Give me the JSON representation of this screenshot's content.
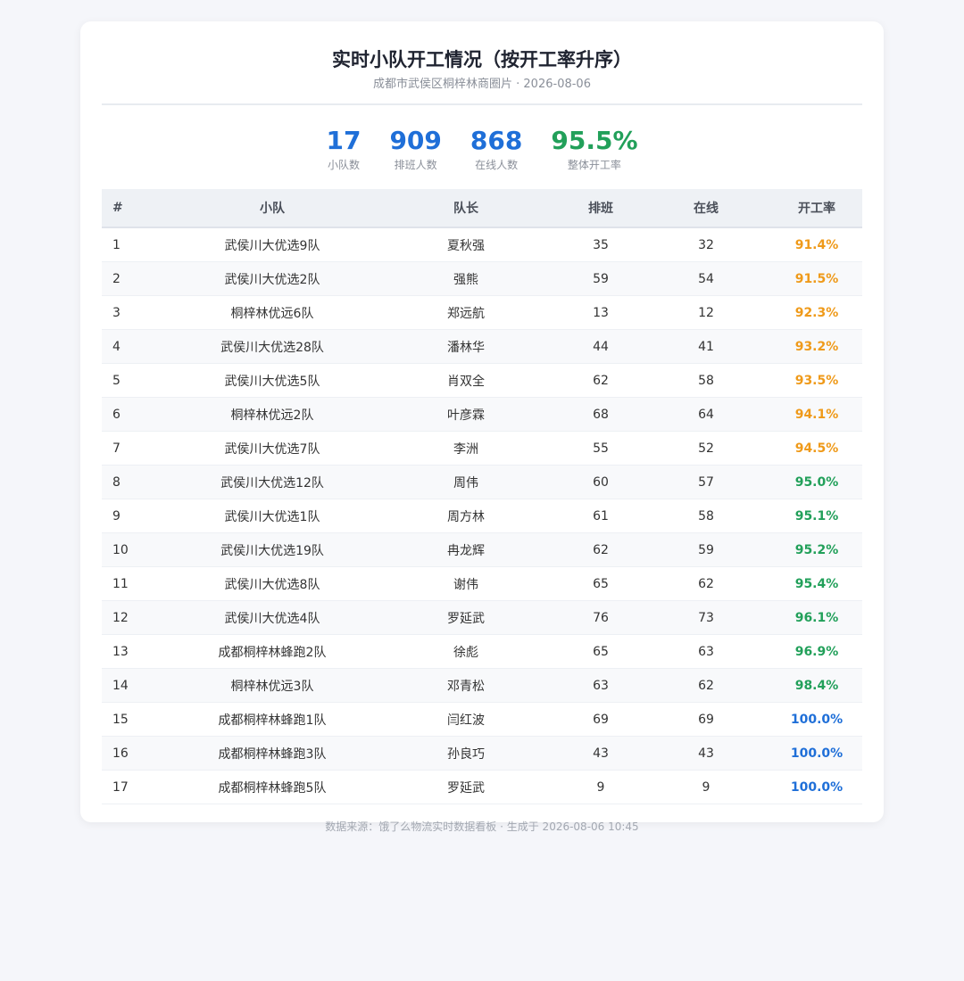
{
  "header": {
    "title": "实时小队开工情况（按开工率升序）",
    "subtitle": "成都市武侯区桐梓林商圈片 · 2026-08-06"
  },
  "stats": [
    {
      "value": "17",
      "label": "小队数",
      "color": "#1f6fd8"
    },
    {
      "value": "909",
      "label": "排班人数",
      "color": "#1f6fd8"
    },
    {
      "value": "868",
      "label": "在线人数",
      "color": "#1f6fd8"
    },
    {
      "value": "95.5%",
      "label": "整体开工率",
      "color": "#22a05a"
    }
  ],
  "table": {
    "columns": [
      "#",
      "小队",
      "队长",
      "排班",
      "在线",
      "开工率"
    ],
    "rows": [
      {
        "idx": "1",
        "team": "武侯川大优选9队",
        "leader": "夏秋强",
        "scheduled": "35",
        "online": "32",
        "rate": "91.4%",
        "rate_color": "orange"
      },
      {
        "idx": "2",
        "team": "武侯川大优选2队",
        "leader": "强熊",
        "scheduled": "59",
        "online": "54",
        "rate": "91.5%",
        "rate_color": "orange"
      },
      {
        "idx": "3",
        "team": "桐梓林优远6队",
        "leader": "郑远航",
        "scheduled": "13",
        "online": "12",
        "rate": "92.3%",
        "rate_color": "orange"
      },
      {
        "idx": "4",
        "team": "武侯川大优选28队",
        "leader": "潘林华",
        "scheduled": "44",
        "online": "41",
        "rate": "93.2%",
        "rate_color": "orange"
      },
      {
        "idx": "5",
        "team": "武侯川大优选5队",
        "leader": "肖双全",
        "scheduled": "62",
        "online": "58",
        "rate": "93.5%",
        "rate_color": "orange"
      },
      {
        "idx": "6",
        "team": "桐梓林优远2队",
        "leader": "叶彦霖",
        "scheduled": "68",
        "online": "64",
        "rate": "94.1%",
        "rate_color": "orange"
      },
      {
        "idx": "7",
        "team": "武侯川大优选7队",
        "leader": "李洲",
        "scheduled": "55",
        "online": "52",
        "rate": "94.5%",
        "rate_color": "orange"
      },
      {
        "idx": "8",
        "team": "武侯川大优选12队",
        "leader": "周伟",
        "scheduled": "60",
        "online": "57",
        "rate": "95.0%",
        "rate_color": "green"
      },
      {
        "idx": "9",
        "team": "武侯川大优选1队",
        "leader": "周方林",
        "scheduled": "61",
        "online": "58",
        "rate": "95.1%",
        "rate_color": "green"
      },
      {
        "idx": "10",
        "team": "武侯川大优选19队",
        "leader": "冉龙辉",
        "scheduled": "62",
        "online": "59",
        "rate": "95.2%",
        "rate_color": "green"
      },
      {
        "idx": "11",
        "team": "武侯川大优选8队",
        "leader": "谢伟",
        "scheduled": "65",
        "online": "62",
        "rate": "95.4%",
        "rate_color": "green"
      },
      {
        "idx": "12",
        "team": "武侯川大优选4队",
        "leader": "罗延武",
        "scheduled": "76",
        "online": "73",
        "rate": "96.1%",
        "rate_color": "green"
      },
      {
        "idx": "13",
        "team": "成都桐梓林蜂跑2队",
        "leader": "徐彪",
        "scheduled": "65",
        "online": "63",
        "rate": "96.9%",
        "rate_color": "green"
      },
      {
        "idx": "14",
        "team": "桐梓林优远3队",
        "leader": "邓青松",
        "scheduled": "63",
        "online": "62",
        "rate": "98.4%",
        "rate_color": "green"
      },
      {
        "idx": "15",
        "team": "成都桐梓林蜂跑1队",
        "leader": "闫红波",
        "scheduled": "69",
        "online": "69",
        "rate": "100.0%",
        "rate_color": "blue"
      },
      {
        "idx": "16",
        "team": "成都桐梓林蜂跑3队",
        "leader": "孙良巧",
        "scheduled": "43",
        "online": "43",
        "rate": "100.0%",
        "rate_color": "blue"
      },
      {
        "idx": "17",
        "team": "成都桐梓林蜂跑5队",
        "leader": "罗延武",
        "scheduled": "9",
        "online": "9",
        "rate": "100.0%",
        "rate_color": "blue"
      }
    ]
  },
  "footer": {
    "text": "数据来源：饿了么物流实时数据看板 · 生成于 2026-08-06 10:45"
  },
  "colors": {
    "primary_blue": "#1f6fd8",
    "green": "#22a05a",
    "orange": "#ef9a1a"
  }
}
